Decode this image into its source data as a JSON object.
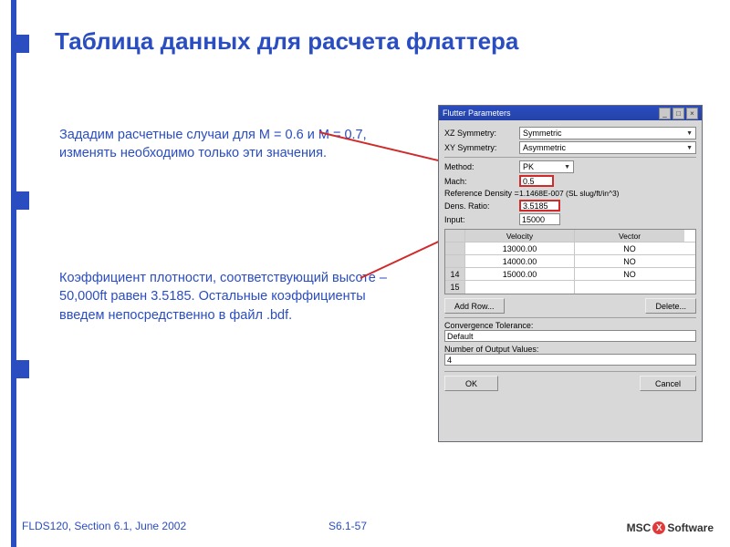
{
  "title": "Таблица данных для расчета флаттера",
  "para1": "Зададим расчетные случаи для M = 0.6 и  M = 0.7, изменять необходимо только эти значения.",
  "para2": "Коэффициент плотности, соответствующий высоте –50,000ft равен 3.5185. Остальные коэффициенты введем непосредственно в файл .bdf.",
  "footer": {
    "left": "FLDS120, Section 6.1, June 2002",
    "center": "S6.1-57"
  },
  "logo": {
    "a": "MSC",
    "b": "Software"
  },
  "dialog": {
    "title": "Flutter Parameters",
    "xz": {
      "label": "XZ Symmetry:",
      "value": "Symmetric"
    },
    "xy": {
      "label": "XY Symmetry:",
      "value": "Asymmetric"
    },
    "method": {
      "label": "Method:",
      "value": "PK"
    },
    "mach": {
      "label": "Mach:",
      "value": "0.5"
    },
    "refdens": {
      "label": "Reference Density =",
      "value": "1.1468E-007  (SL slug/ft/in^3)"
    },
    "densratio": {
      "label": "Dens. Ratio:",
      "value": "3.5185"
    },
    "input": {
      "label": "Input:",
      "value": "15000"
    },
    "headers": {
      "velocity": "Velocity",
      "vector": "Vector"
    },
    "rows": [
      {
        "idx": "",
        "velocity": "13000.00",
        "vector": "NO"
      },
      {
        "idx": "",
        "velocity": "14000.00",
        "vector": "NO"
      },
      {
        "idx": "14",
        "velocity": "15000.00",
        "vector": "NO"
      },
      {
        "idx": "15",
        "velocity": "",
        "vector": ""
      }
    ],
    "buttons": {
      "add": "Add Row...",
      "del": "Delete...",
      "ok": "OK",
      "cancel": "Cancel"
    },
    "conv": {
      "label": "Convergence Tolerance:",
      "value": "Default"
    },
    "nout": {
      "label": "Number of Output Values:",
      "value": "4"
    }
  }
}
